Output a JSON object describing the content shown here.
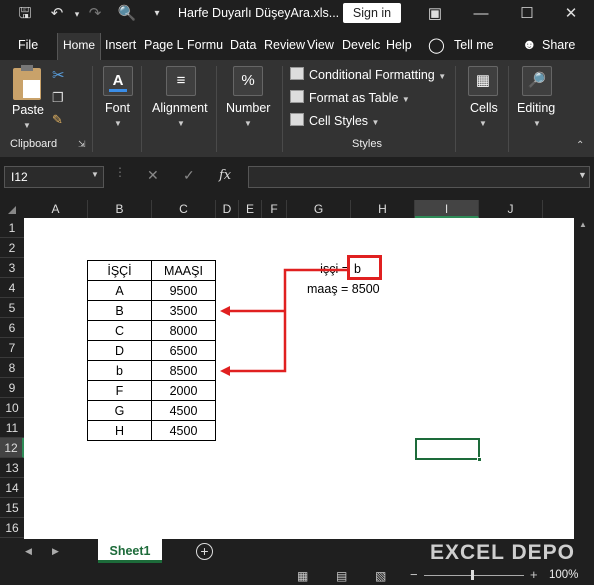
{
  "title_bar": {
    "doc_title": "Harfe Duyarlı DüşeyAra.xls...",
    "sign_in": "Sign in"
  },
  "tabs": [
    "File",
    "Home",
    "Insert",
    "Page L",
    "Formu",
    "Data",
    "Review",
    "View",
    "Develc",
    "Help"
  ],
  "tell_me": "Tell me",
  "share": "Share",
  "ribbon": {
    "paste": "Paste",
    "clipboard": "Clipboard",
    "font": "Font",
    "alignment": "Alignment",
    "number": "Number",
    "conditional_formatting": "Conditional Formatting",
    "format_as_table": "Format as Table",
    "cell_styles": "Cell Styles",
    "styles": "Styles",
    "cells": "Cells",
    "editing": "Editing"
  },
  "formula_bar": {
    "name_box": "I12",
    "fx": "fx",
    "formula": ""
  },
  "columns": [
    "A",
    "B",
    "C",
    "D",
    "E",
    "F",
    "G",
    "H",
    "I",
    "J"
  ],
  "rows": [
    "1",
    "2",
    "3",
    "4",
    "5",
    "6",
    "7",
    "8",
    "9",
    "10",
    "11",
    "12",
    "13",
    "14",
    "15",
    "16"
  ],
  "table": {
    "headers": [
      "İŞÇİ",
      "MAAŞI"
    ],
    "rows": [
      [
        "A",
        "9500"
      ],
      [
        "B",
        "3500"
      ],
      [
        "C",
        "8000"
      ],
      [
        "D",
        "6500"
      ],
      [
        "b",
        "8500"
      ],
      [
        "F",
        "2000"
      ],
      [
        "G",
        "4500"
      ],
      [
        "H",
        "4500"
      ]
    ]
  },
  "lookup": {
    "label1": "işçi =",
    "value1": "b",
    "label2": "maaş = 8500"
  },
  "sheet_tab": "Sheet1",
  "zoom": "100%",
  "watermark": "EXCEL DEPO",
  "colors": {
    "accent_green": "#1d6b3a",
    "highlight_red": "#e02020"
  }
}
